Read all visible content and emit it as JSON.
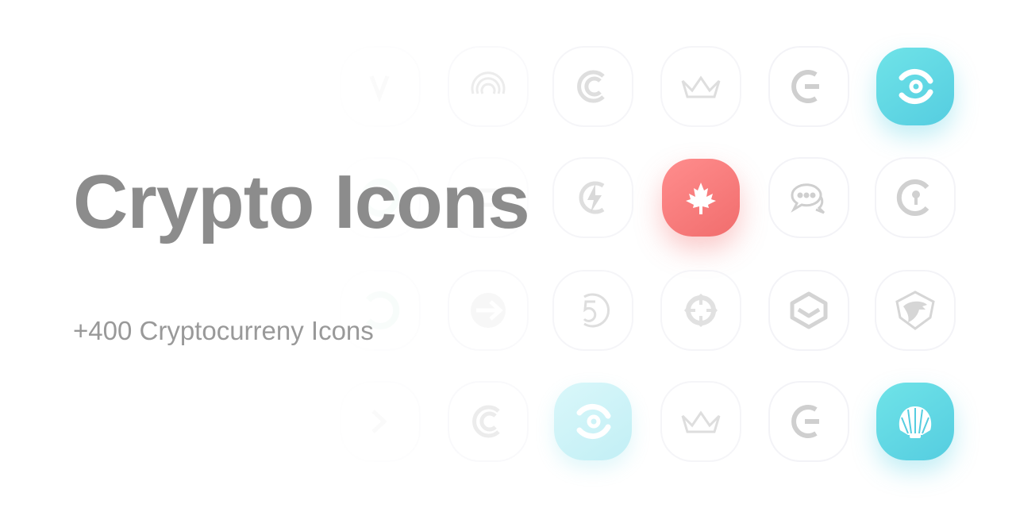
{
  "hero": {
    "title": "Crypto Icons",
    "subtitle": "+400 Cryptocurreny Icons"
  },
  "colors": {
    "title": "#8c8c8c",
    "subtitle": "#999999",
    "teal_accent": "#55cde0",
    "red_accent": "#f16d6d",
    "icon_gray": "#d9d9d9"
  },
  "icons": [
    {
      "name": "fade-glyph-icon"
    },
    {
      "name": "concentric-arcs-icon"
    },
    {
      "name": "c-swirl-icon"
    },
    {
      "name": "crown-outline-icon"
    },
    {
      "name": "c-stack-icon"
    },
    {
      "name": "ring-dot-icon",
      "accent": "teal"
    },
    {
      "name": "lightning-c-icon"
    },
    {
      "name": "maple-leaf-icon",
      "accent": "red"
    },
    {
      "name": "chat-bubbles-icon"
    },
    {
      "name": "c-keyhole-icon"
    },
    {
      "name": "arrow-circle-icon"
    },
    {
      "name": "five-swirl-icon"
    },
    {
      "name": "recycle-arrows-icon"
    },
    {
      "name": "layer-box-icon"
    },
    {
      "name": "eagle-shield-icon"
    },
    {
      "name": "shell-icon",
      "accent": "teal"
    }
  ]
}
